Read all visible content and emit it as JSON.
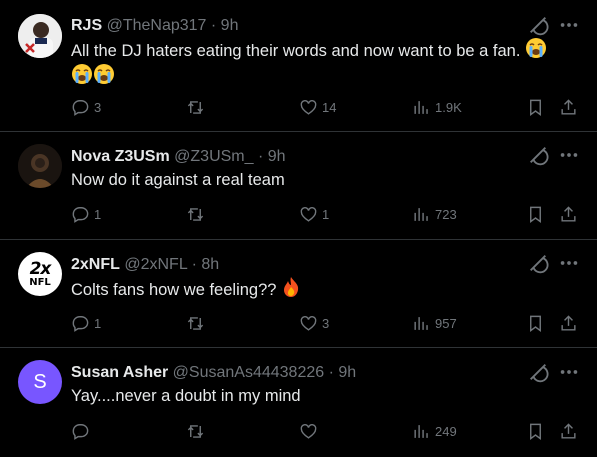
{
  "tweets": [
    {
      "name": "RJS",
      "handle": "@TheNap317",
      "dot": "·",
      "time": "9h",
      "text": "All the DJ haters eating their words and now want to be a fan.",
      "emoji_after_text": [
        "loudly-crying-face",
        "loudly-crying-face",
        "loudly-crying-face"
      ],
      "avatar": {
        "type": "photo",
        "colors": [
          "#f5f5f5",
          "#1b2a52",
          "#c62828"
        ]
      },
      "replies": "3",
      "retweets": "",
      "likes": "14",
      "views": "1.9K"
    },
    {
      "name": "Nova Z3USm",
      "handle": "@Z3USm_",
      "dot": "·",
      "time": "9h",
      "text": "Now do it against a real team",
      "avatar": {
        "type": "photo",
        "colors": [
          "#1a1410",
          "#6b4a2a",
          "#2a1f18"
        ]
      },
      "replies": "1",
      "retweets": "",
      "likes": "1",
      "views": "723"
    },
    {
      "name": "2xNFL",
      "handle": "@2xNFL",
      "dot": "·",
      "time": "8h",
      "text": "Colts fans how we feeling??",
      "emoji_after_text": [
        "fire"
      ],
      "avatar": {
        "type": "logo",
        "line1": "2x",
        "line2": "NFL",
        "bg": "#ffffff",
        "fg": "#000000"
      },
      "replies": "1",
      "retweets": "",
      "likes": "3",
      "views": "957"
    },
    {
      "name": "Susan Asher",
      "handle": "@SusanAs44438226",
      "dot": "·",
      "time": "9h",
      "text": "Yay....never a doubt in my mind",
      "avatar": {
        "type": "initial",
        "letter": "S",
        "bg": "#7856ff"
      },
      "replies": "",
      "retweets": "",
      "likes": "",
      "views": "249"
    }
  ],
  "colors": {
    "background": "#000000",
    "divider": "#2f3336",
    "primary_text": "#e7e9ea",
    "secondary_text": "#71767b"
  },
  "icons": [
    "reply-icon",
    "retweet-icon",
    "like-icon",
    "views-icon",
    "bookmark-icon",
    "share-icon",
    "grok-icon",
    "more-icon"
  ]
}
